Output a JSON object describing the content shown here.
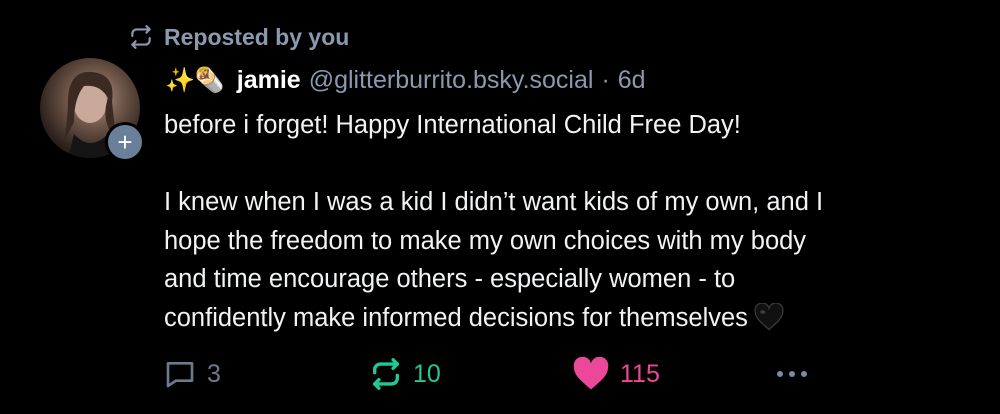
{
  "repost_label": "Reposted by you",
  "author": {
    "emoji": "✨🌯",
    "name": "jamie",
    "handle": "@glitterburrito.bsky.social",
    "separator": "·",
    "time": "6d"
  },
  "post": {
    "line1": "before i forget! Happy International Child Free Day!",
    "paragraph2": [
      "I knew when I was a kid I didn’t want kids of my own, and I",
      "hope the freedom to make my own choices with my body",
      "and time encourage others - especially women - to",
      "confidently make informed decisions for themselves"
    ],
    "trailing_emoji": "black-heart"
  },
  "actions": {
    "reply_count": "3",
    "repost_count": "10",
    "like_count": "115"
  },
  "colors": {
    "background": "#000000",
    "muted": "#8a99ad",
    "repost_active": "#20c997",
    "like_active": "#ec4899"
  },
  "icons": {
    "repost": "repost-icon",
    "reply": "reply-icon",
    "like": "heart-icon",
    "more": "more-icon",
    "follow": "plus-icon"
  }
}
